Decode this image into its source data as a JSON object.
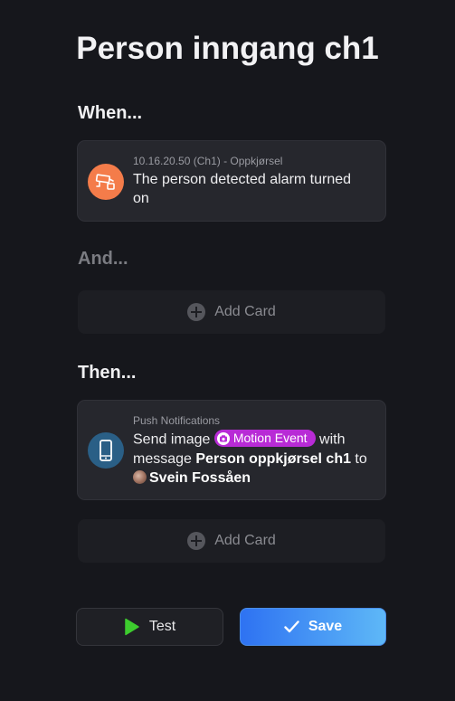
{
  "title": "Person inngang ch1",
  "when": {
    "label": "When...",
    "card": {
      "subtitle": "10.16.20.50 (Ch1) - Oppkjørsel",
      "text": "The person detected alarm turned on",
      "icon": "camera-icon",
      "icon_color": "#f47c4a"
    }
  },
  "and": {
    "label": "And...",
    "add_label": "Add Card"
  },
  "then": {
    "label": "Then...",
    "card": {
      "subtitle": "Push Notifications",
      "text_send": "Send image",
      "tag_label": "Motion Event",
      "text_with": " with message ",
      "message": "Person oppkjørsel ch1",
      "text_to": " to",
      "recipient": "Svein Fossåen",
      "icon": "phone-icon",
      "icon_color": "#2a5f86",
      "tag_color": "#b82bd6"
    },
    "add_label": "Add Card"
  },
  "buttons": {
    "test_label": "Test",
    "save_label": "Save"
  }
}
